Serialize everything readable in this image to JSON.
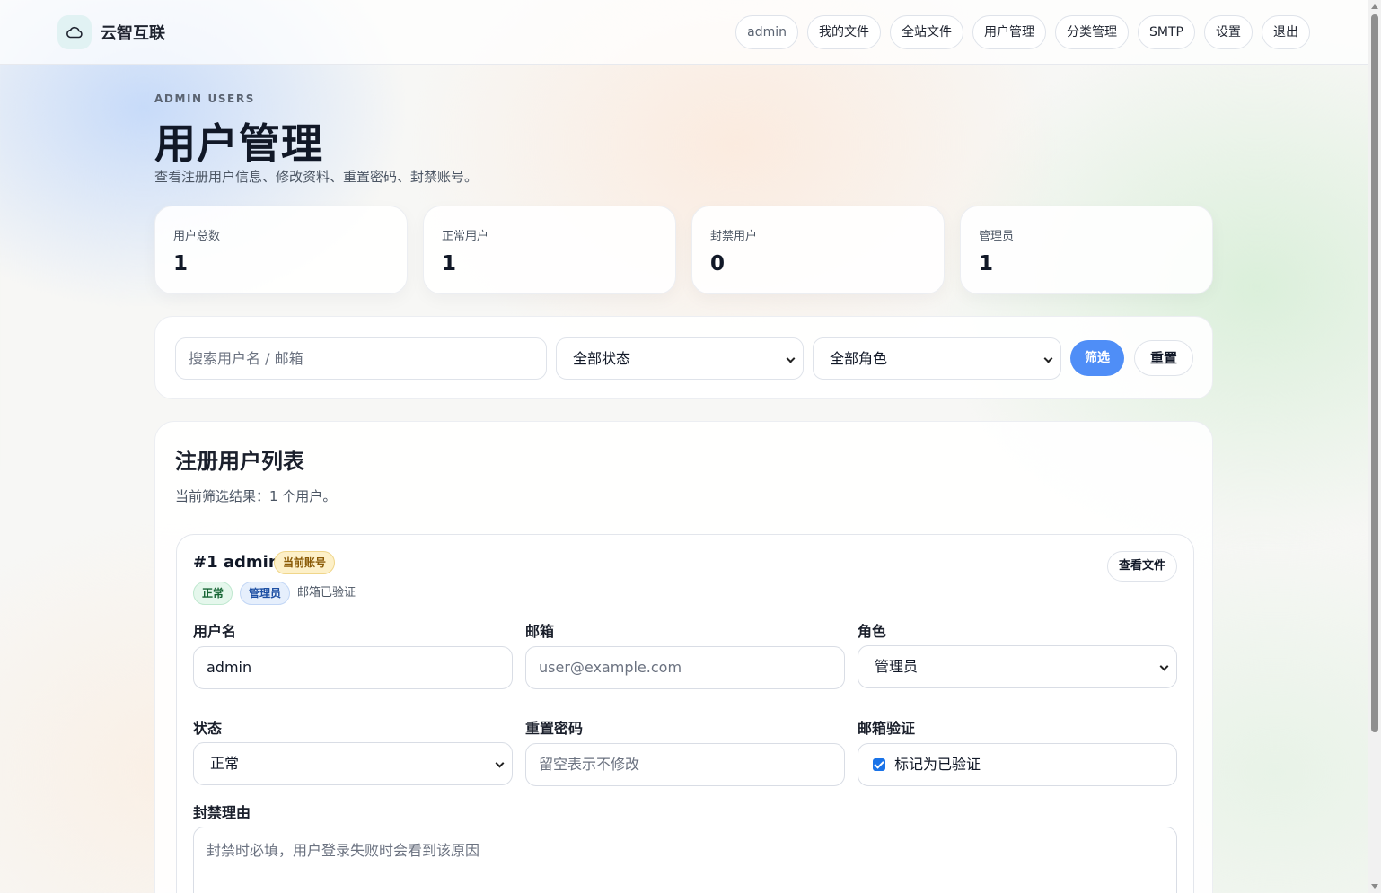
{
  "header": {
    "brand": "云智互联",
    "nav": [
      "admin",
      "我的文件",
      "全站文件",
      "用户管理",
      "分类管理",
      "SMTP",
      "设置",
      "退出"
    ]
  },
  "page": {
    "eyebrow": "ADMIN USERS",
    "title": "用户管理",
    "subtitle": "查看注册用户信息、修改资料、重置密码、封禁账号。"
  },
  "stats": [
    {
      "label": "用户总数",
      "value": "1"
    },
    {
      "label": "正常用户",
      "value": "1"
    },
    {
      "label": "封禁用户",
      "value": "0"
    },
    {
      "label": "管理员",
      "value": "1"
    }
  ],
  "filter": {
    "search_placeholder": "搜索用户名 / 邮箱",
    "status_value": "全部状态",
    "role_value": "全部角色",
    "filter_button": "筛选",
    "reset_button": "重置"
  },
  "list": {
    "title": "注册用户列表",
    "summary": "当前筛选结果：1 个用户。"
  },
  "user": {
    "heading": "#1 admin",
    "current_badge": "当前账号",
    "status_tag": "正常",
    "role_tag": "管理员",
    "email_verified_text": "邮箱已验证",
    "view_files_button": "查看文件",
    "labels": {
      "username": "用户名",
      "email": "邮箱",
      "role": "角色",
      "status": "状态",
      "reset_password": "重置密码",
      "email_verify": "邮箱验证",
      "ban_reason": "封禁理由"
    },
    "username_value": "admin",
    "email_placeholder": "user@example.com",
    "role_value": "管理员",
    "status_value": "正常",
    "password_placeholder": "留空表示不修改",
    "verify_checkbox_label": "标记为已验证",
    "verify_checked": true,
    "ban_reason_placeholder": "封禁时必填，用户登录失败时会看到该原因"
  },
  "colors": {
    "accent": "#4f8ef7",
    "current_badge_bg": "#fdf0c8",
    "status_tag_bg": "#e5f7ec",
    "role_tag_bg": "#e6effc"
  },
  "icons": {
    "brand": "cloud-icon"
  }
}
